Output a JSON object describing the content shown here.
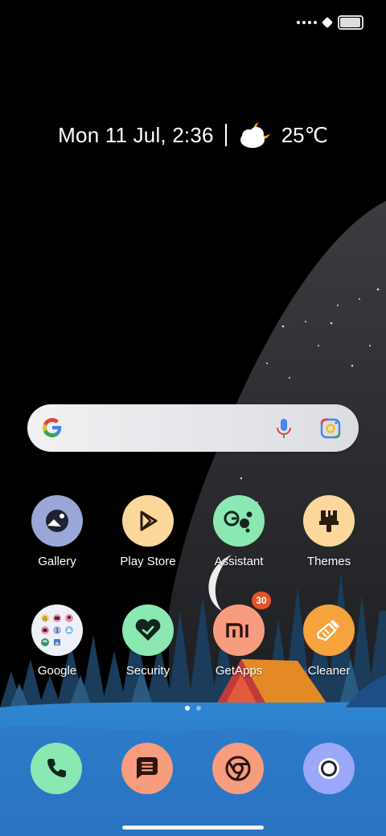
{
  "status_bar": {
    "signal_icon": "signal-dots-icon",
    "wifi_icon": "wifi-icon",
    "battery_icon": "battery-icon",
    "battery_level": 0.95
  },
  "clock_widget": {
    "date_time": "Mon 11 Jul, 2:36",
    "weather_icon": "cloudy-night-icon",
    "temperature": "25℃"
  },
  "search_bar": {
    "logo_icon": "google-g-icon",
    "mic_icon": "mic-icon",
    "lens_icon": "lens-icon"
  },
  "apps": [
    {
      "label": "Gallery",
      "icon": "gallery-icon",
      "color": "#9ba7d8"
    },
    {
      "label": "Play Store",
      "icon": "play-store-icon",
      "color": "#fcd79c"
    },
    {
      "label": "Assistant",
      "icon": "assistant-icon",
      "color": "#8be8b3"
    },
    {
      "label": "Themes",
      "icon": "themes-icon",
      "color": "#fcd79c"
    },
    {
      "label": "Google",
      "icon": "google-folder-icon",
      "color": "#eef0f8"
    },
    {
      "label": "Security",
      "icon": "security-icon",
      "color": "#8be8b3"
    },
    {
      "label": "GetApps",
      "icon": "getapps-icon",
      "color": "#f89c7e",
      "badge": "30"
    },
    {
      "label": "Cleaner",
      "icon": "cleaner-icon",
      "color": "#f6a33d"
    }
  ],
  "pager": {
    "pages": 2,
    "current": 1
  },
  "dock": [
    {
      "name": "phone",
      "icon": "phone-icon",
      "color": "#8be8b3"
    },
    {
      "name": "messages",
      "icon": "messages-icon",
      "color": "#f89c7e"
    },
    {
      "name": "chrome",
      "icon": "chrome-icon",
      "color": "#f89c7e"
    },
    {
      "name": "camera",
      "icon": "camera-icon",
      "color": "#9ba7f8"
    }
  ],
  "colors": {
    "accent_green": "#8be8b3",
    "accent_yellow": "#fcd79c",
    "accent_coral": "#f89c7e",
    "accent_blue": "#9ba7d8",
    "badge": "#e5532a"
  }
}
